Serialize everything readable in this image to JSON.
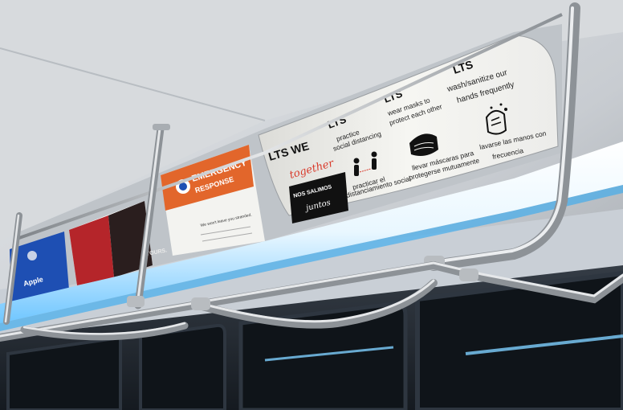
{
  "scene": {
    "colors": {
      "ceiling": "#cfd3d8",
      "ceiling_shadow": "#8a9096",
      "panel_white": "#f2f2ee",
      "light_strip": "#dff3ff",
      "light_glow": "#7fd0ff",
      "dark_interior": "#1d232b",
      "pole": "#9ea3a8",
      "pole_highlight": "#e6e8ea",
      "accent_red": "#d93a2b",
      "accent_orange": "#e2662b",
      "accent_blue": "#1e4fb3",
      "accent_black": "#111111"
    }
  },
  "signs": {
    "main": {
      "logo": "LTS",
      "brand_top": "LTS WE",
      "brand_script": "together",
      "brand_es_top": "NOS SALIMOS",
      "brand_es_script": "juntos",
      "tips": [
        {
          "logo": "LTS",
          "en": [
            "practice",
            "social distancing"
          ],
          "es": [
            "practicar el",
            "distanciamiento social"
          ],
          "icon": "social-distancing-icon"
        },
        {
          "logo": "LTS",
          "en": [
            "wear masks to",
            "protect each other"
          ],
          "es": [
            "llevar máscaras para",
            "protegerse mutuamente"
          ],
          "icon": "face-mask-icon"
        },
        {
          "logo": "LTS",
          "en": [
            "wash/sanitize our",
            "hands frequently"
          ],
          "es": [
            "lavarse las manos con",
            "frecuencia"
          ],
          "icon": "hand-washing-icon"
        }
      ]
    },
    "emergency": {
      "title_top": "EMERGENCY",
      "title_bottom": "RESPONSE",
      "body": "We won't leave you stranded."
    },
    "left_red": {
      "text": "YOURS."
    },
    "left_blue": {
      "text": "Apple"
    }
  }
}
